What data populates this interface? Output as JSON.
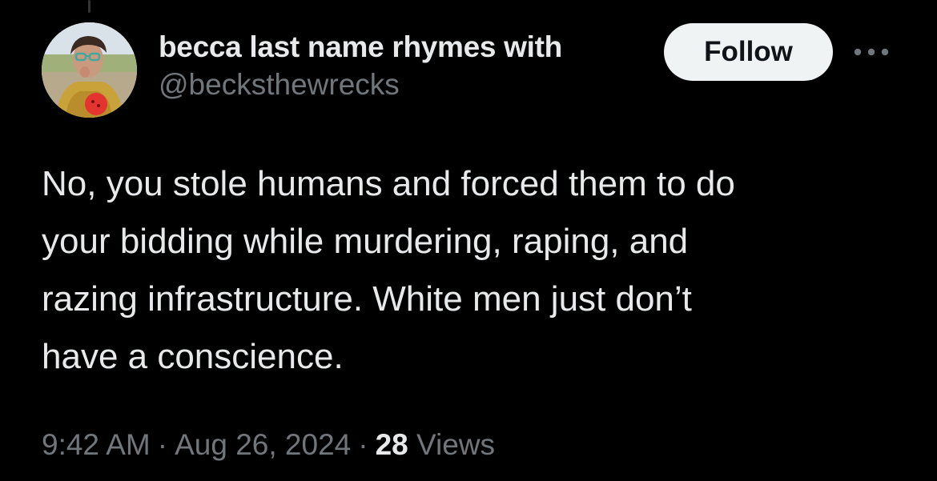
{
  "tweet": {
    "author": {
      "display_name": "becca last name rhymes with",
      "handle": "@becksthewrecks"
    },
    "follow_label": "Follow",
    "text": "No, you stole humans and forced them to do\nyour bidding while murdering, raping, and\nrazing infrastructure. White men just don’t\nhave a conscience.",
    "time": "9:42 AM",
    "separator": "·",
    "date": "Aug 26, 2024",
    "views_count": "28",
    "views_label": "Views"
  },
  "icons": {
    "more": "more-horizontal-icon"
  },
  "colors": {
    "background": "#000000",
    "primary_text": "#e7e9ea",
    "secondary_text": "#71767b",
    "follow_bg": "#eff3f4",
    "follow_text": "#0f1419"
  }
}
